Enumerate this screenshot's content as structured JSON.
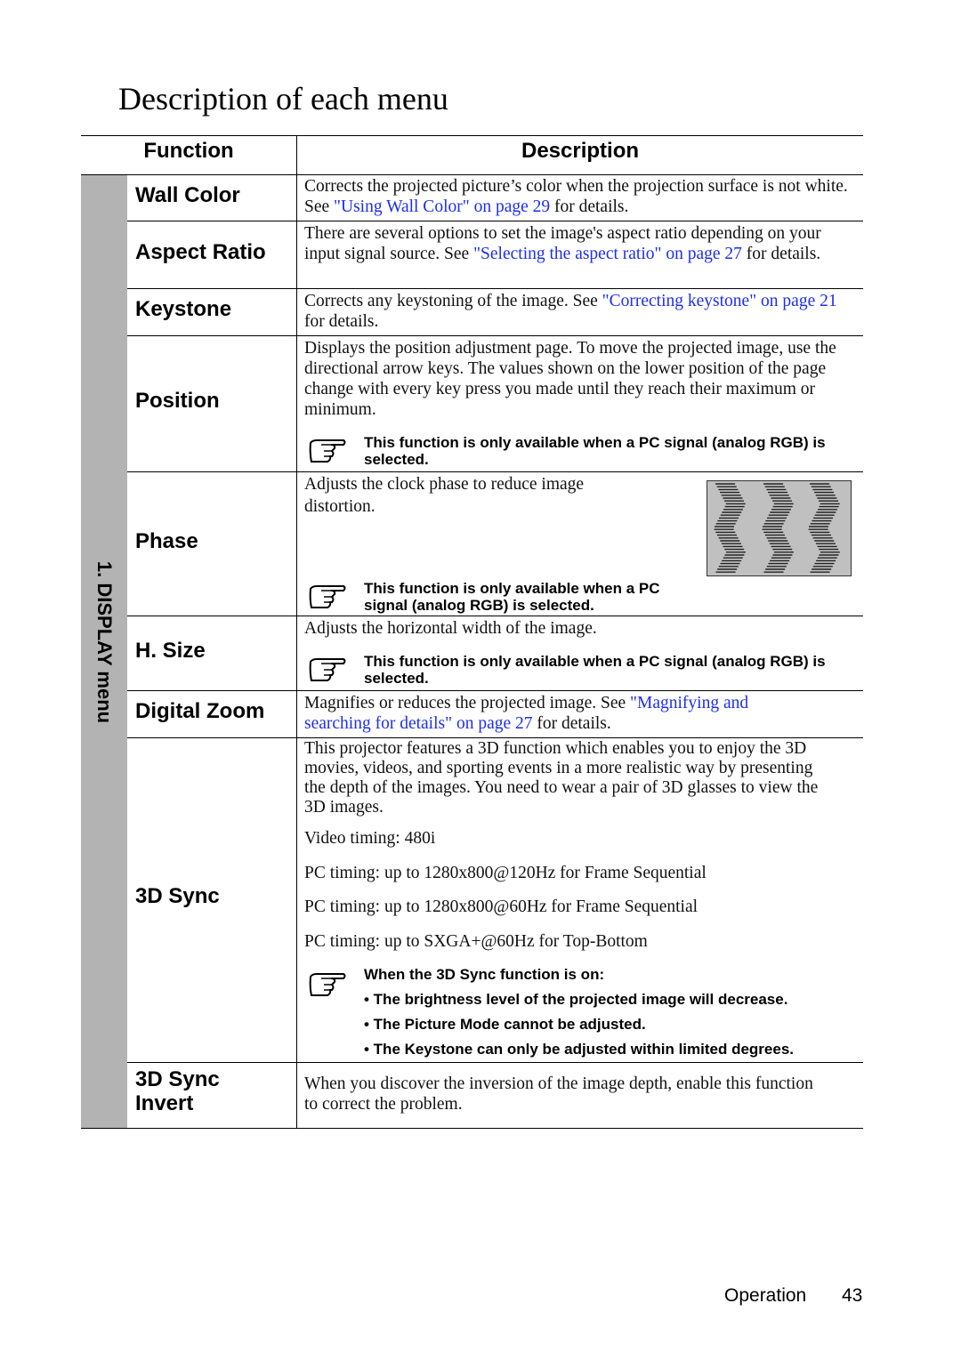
{
  "title": "Description of each menu",
  "headers": {
    "function": "Function",
    "description": "Description"
  },
  "side_label": "1. DISPLAY menu",
  "rows": {
    "wall_color": {
      "name": "Wall Color",
      "t1": "Corrects the projected picture’s color when the projection surface is not white. See ",
      "link": "\"Using Wall Color\" on page 29",
      "t2": " for details."
    },
    "aspect": {
      "name": "Aspect Ratio",
      "t1": "There are several options to set the image's aspect ratio depending on your input signal source. See ",
      "link": "\"Selecting the aspect ratio\" on page 27",
      "t2": " for details."
    },
    "keystone": {
      "name": "Keystone",
      "t1": "Corrects any keystoning of the image. See ",
      "link": "\"Correcting keystone\" on page 21",
      "t2": " for details."
    },
    "position": {
      "name": "Position",
      "t1": "Displays the position adjustment page. To move the projected image, use the directional arrow keys. The values shown on the lower position of the page change with every key press you made until they reach their maximum or minimum.",
      "note": "This function is only available when a PC signal (analog RGB) is selected."
    },
    "phase": {
      "name": "Phase",
      "t1": "Adjusts the clock phase to reduce image distortion.",
      "note": "This function is only available when a PC signal (analog RGB) is selected."
    },
    "hsize": {
      "name": "H. Size",
      "t1": "Adjusts the horizontal width of the image.",
      "note": "This function is only available when a PC signal (analog RGB) is selected."
    },
    "zoom": {
      "name": "Digital Zoom",
      "t1": "Magnifies or reduces the projected image. See ",
      "link": "\"Magnifying and searching for details\" on page 27",
      "t2": " for details."
    },
    "sync": {
      "name": "3D Sync",
      "t1": "This projector features a 3D function which enables you to enjoy the 3D movies, videos, and sporting events in a more realistic way by presenting the depth of the images. You need to wear a pair of 3D glasses to view the 3D images.",
      "lines": [
        "Video timing: 480i",
        "PC timing: up to 1280x800@120Hz for Frame Sequential",
        "PC timing: up to 1280x800@60Hz for Frame Sequential",
        "PC timing: up to SXGA+@60Hz for Top-Bottom"
      ],
      "note_title": "When the 3D Sync function is on:",
      "bullets": [
        "• The brightness level of the projected image will decrease.",
        "•  The Picture Mode cannot be adjusted.",
        "• The Keystone can only be adjusted within limited degrees."
      ]
    },
    "invert": {
      "name1": "3D Sync",
      "name2": "Invert",
      "t1": "When you discover the inversion of the image depth, enable this function to correct the problem."
    }
  },
  "footer": {
    "section": "Operation",
    "page": "43"
  },
  "colors": {
    "link": "#1d2ef0",
    "sidebar": "#b3b3b3"
  }
}
